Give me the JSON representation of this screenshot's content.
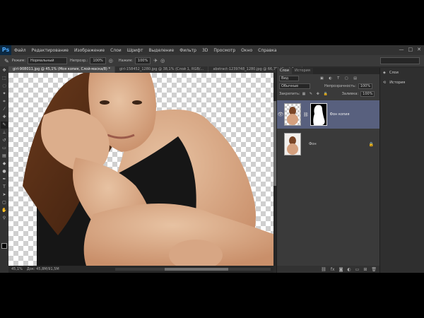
{
  "app": {
    "logo": "Ps"
  },
  "menu": [
    "Файл",
    "Редактирование",
    "Изображение",
    "Слои",
    "Шрифт",
    "Выделение",
    "Фильтр",
    "3D",
    "Просмотр",
    "Окно",
    "Справка"
  ],
  "window_controls": {
    "minimize": "—",
    "maximize": "□",
    "close": "✕"
  },
  "options_bar": {
    "mode_label": "Режим:",
    "mode_value": "Нормальный",
    "opacity_label": "Непрозр.:",
    "opacity_value": "100%",
    "flow_label": "Нажим:",
    "flow_value": "100%"
  },
  "doc_tabs": [
    "girl-908011.jpg @ 45,1% (Моя копия, Слой-маска/8) *",
    "girl-158452_1280.jpg @ 38,1% (Слой 1, RGB/…",
    "abstract-1239748_1280.jpg @ 66,7% (Слой 1…"
  ],
  "status": {
    "zoom": "45,1%",
    "doc": "Док: 45,8M/91,5M"
  },
  "layers_panel": {
    "tabs": [
      "Слои",
      "История"
    ],
    "filter": "Вид",
    "blend_mode": "Обычные",
    "opacity_label": "Непрозрачность:",
    "opacity_value": "100%",
    "lock_label": "Закрепить:",
    "fill_label": "Заливка:",
    "fill_value": "100%",
    "layers": [
      {
        "name": "Фон копия",
        "selected": true,
        "has_mask": true
      },
      {
        "name": "Фон",
        "selected": false,
        "has_mask": false
      }
    ],
    "bottom_icons": [
      "link-icon",
      "fx-icon",
      "mask-icon",
      "adjustment-icon",
      "folder-icon",
      "new-layer-icon",
      "trash-icon"
    ]
  },
  "dock": {
    "items": [
      {
        "label": "Слои",
        "icon": "layers-icon"
      },
      {
        "label": "История",
        "icon": "history-icon"
      }
    ]
  },
  "colors": {
    "accent": "#58607e",
    "ui_dark": "#2b2b2b",
    "panel": "#3a3a3a"
  }
}
